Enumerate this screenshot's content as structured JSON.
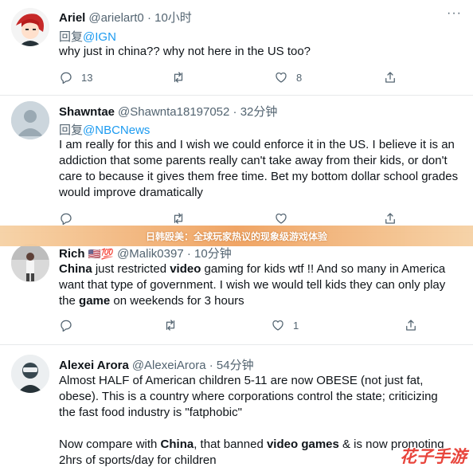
{
  "banner": {
    "text": "日韩殴美：全球玩家热议的现象级游戏体验"
  },
  "watermark": {
    "text": "花子手游"
  },
  "tweets": [
    {
      "name": "Ariel",
      "handle": "@arielart0",
      "time": "· 10小时",
      "reply_prefix": "回复",
      "reply_to": "@IGN",
      "lines": [
        "why just in china?? why not here in the US too?"
      ],
      "reply_count": "13",
      "retweet_count": "",
      "like_count": "8"
    },
    {
      "name": "Shawntae",
      "handle": "@Shawnta18197052",
      "time": "· 32分钟",
      "reply_prefix": "回复",
      "reply_to": "@NBCNews",
      "lines": [
        "I am really for this and I wish we could enforce it in the US. I believe it is an",
        "addiction that some parents really can't take away from their kids, or don't",
        "care to because it gives them free time. Bet my bottom dollar school grades",
        "would improve dramatically"
      ],
      "reply_count": "",
      "retweet_count": "",
      "like_count": ""
    },
    {
      "name": "Rich",
      "emoji": "🇺🇸💯",
      "handle": "@Malik0397",
      "time": "· 10分钟",
      "line1_a": "China",
      "line1_b": " just restricted ",
      "line1_c": "video",
      "line1_d": " gaming for kids wtf !! And so many in America",
      "line2": "want that type of government. I wish we would tell kids they can only play",
      "line3_a": "the ",
      "line3_b": "game",
      "line3_c": " on weekends for 3 hours",
      "reply_count": "",
      "retweet_count": "",
      "like_count": "1"
    },
    {
      "name": "Alexei Arora",
      "handle": "@AlexeiArora",
      "time": "· 54分钟",
      "lines": [
        "Almost HALF of American children 5-11 are now OBESE (not just fat,",
        "obese). This is a country where corporations control the state; criticizing",
        "the fast food industry is \"fatphobic\""
      ],
      "p2_a": "Now compare with ",
      "p2_b": "China",
      "p2_c": ", that banned ",
      "p2_d": "video games",
      "p2_e": " & is now promoting",
      "p2_line2": "2hrs of sports/day for children"
    }
  ],
  "more_label": "···"
}
